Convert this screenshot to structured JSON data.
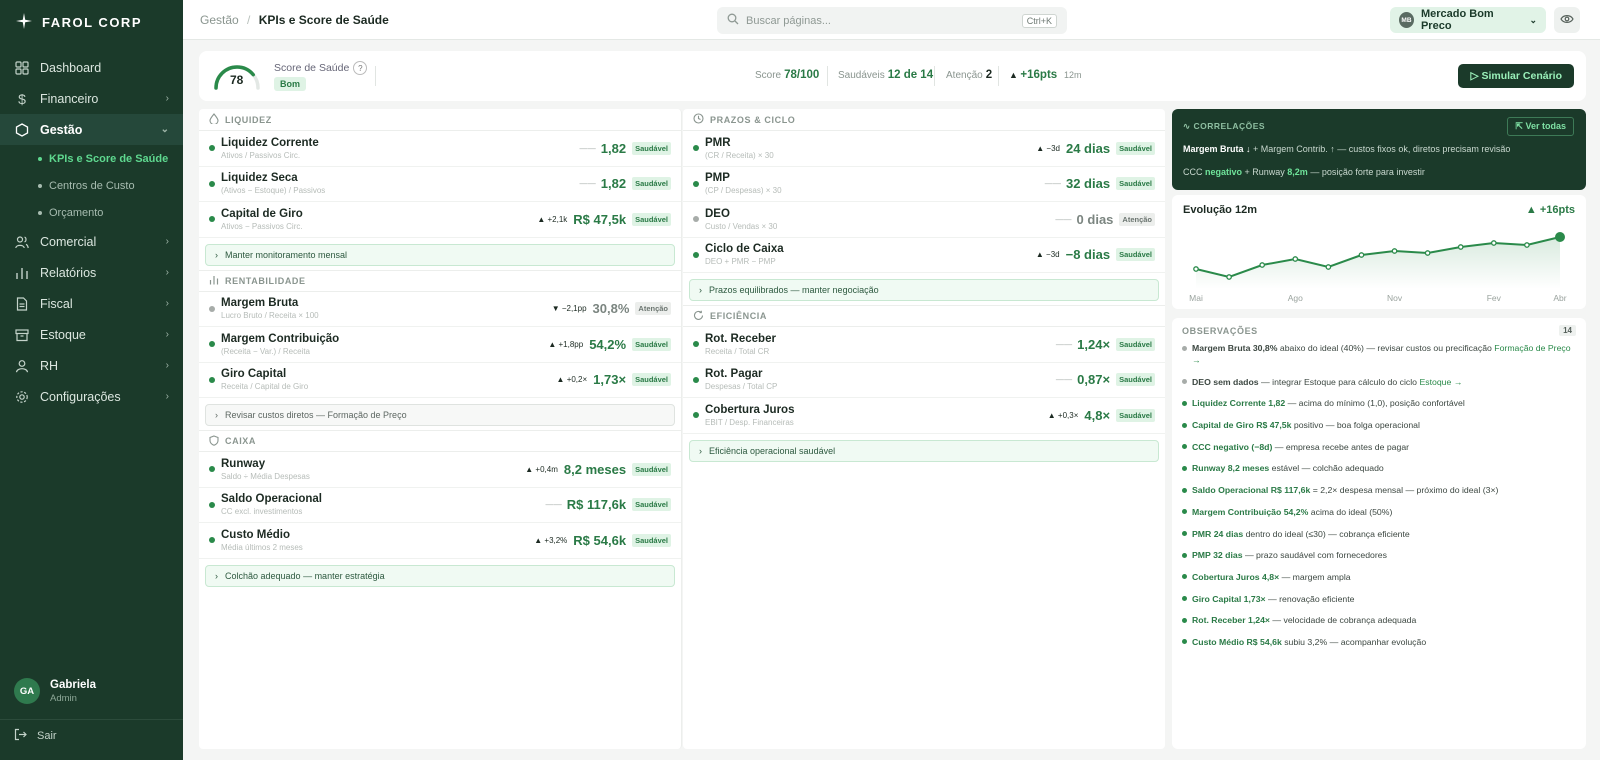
{
  "sidebar": {
    "brand": "FAROL CORP",
    "items": [
      {
        "label": "Dashboard",
        "icon": "grid-icon",
        "chev": false
      },
      {
        "label": "Financeiro",
        "icon": "dollar-icon",
        "chev": true
      },
      {
        "label": "Gestão",
        "icon": "hexagon-icon",
        "chev": true,
        "active": true
      },
      {
        "label": "Comercial",
        "icon": "users-icon",
        "chev": true
      },
      {
        "label": "Relatórios",
        "icon": "bar-chart-icon",
        "chev": true
      },
      {
        "label": "Fiscal",
        "icon": "file-icon",
        "chev": true
      },
      {
        "label": "Estoque",
        "icon": "box-icon",
        "chev": true
      },
      {
        "label": "RH",
        "icon": "user-icon",
        "chev": true
      },
      {
        "label": "Configurações",
        "icon": "gear-icon",
        "chev": true
      }
    ],
    "subitems": [
      "KPIs e Score de Saúde",
      "Centros de Custo",
      "Orçamento"
    ],
    "user": {
      "initials": "GA",
      "name": "Gabriela",
      "role": "Admin"
    },
    "logout": "Sair"
  },
  "topbar": {
    "crumb_parent": "Gestão",
    "crumb_sep": "/",
    "crumb_current": "KPIs e Score de Saúde",
    "search_placeholder": "Buscar páginas...",
    "search_kbd": "Ctrl+K",
    "company_initials": "MB",
    "company": "Mercado Bom Preco"
  },
  "score": {
    "value": "78",
    "label": "Score de Saúde",
    "help": "?",
    "status": "Bom",
    "score_label": "Score",
    "score_value": "78/100",
    "healthy_label": "Saudáveis",
    "healthy_value": "12 de 14",
    "attention_label": "Atenção",
    "attention_value": "2",
    "delta": "+16pts",
    "delta_period": "12m",
    "simulate": "Simular Cenário",
    "gauge_fraction": 0.78
  },
  "col1": {
    "s1": {
      "title": "LIQUIDEZ",
      "rows": [
        {
          "name": "Liquidez Corrente",
          "sub": "Ativos / Passivos Circ.",
          "delta": "— —",
          "value": "1,82",
          "status": "Saudável"
        },
        {
          "name": "Liquidez Seca",
          "sub": "(Ativos − Estoque) / Passivos",
          "delta": "— —",
          "value": "1,82",
          "status": "Saudável"
        },
        {
          "name": "Capital de Giro",
          "sub": "Ativos − Passivos Circ.",
          "delta": "▲ +2,1k",
          "value": "R$ 47,5k",
          "status": "Saudável"
        }
      ],
      "note": "Manter monitoramento mensal"
    },
    "s2": {
      "title": "RENTABILIDADE",
      "rows": [
        {
          "name": "Margem Bruta",
          "sub": "Lucro Bruto / Receita × 100",
          "delta": "▼ −2,1pp",
          "value": "30,8%",
          "status": "Atenção"
        },
        {
          "name": "Margem Contribuição",
          "sub": "(Receita − Var.) / Receita",
          "delta": "▲ +1,8pp",
          "value": "54,2%",
          "status": "Saudável"
        },
        {
          "name": "Giro Capital",
          "sub": "Receita / Capital de Giro",
          "delta": "▲ +0,2×",
          "value": "1,73×",
          "status": "Saudável"
        }
      ],
      "note": "Revisar custos diretos — Formação de Preço"
    },
    "s3": {
      "title": "CAIXA",
      "rows": [
        {
          "name": "Runway",
          "sub": "Saldo ÷ Média Despesas",
          "delta": "▲ +0,4m",
          "value": "8,2 meses",
          "status": "Saudável"
        },
        {
          "name": "Saldo Operacional",
          "sub": "CC excl. investimentos",
          "delta": "— —",
          "value": "R$ 117,6k",
          "status": "Saudável"
        },
        {
          "name": "Custo Médio",
          "sub": "Média últimos 2 meses",
          "delta": "▲ +3,2%",
          "value": "R$ 54,6k",
          "status": "Saudável"
        }
      ],
      "note": "Colchão adequado — manter estratégia"
    }
  },
  "col2": {
    "s1": {
      "title": "PRAZOS & CICLO",
      "rows": [
        {
          "name": "PMR",
          "sub": "(CR / Receita) × 30",
          "delta": "▲ −3d",
          "value": "24 dias",
          "status": "Saudável"
        },
        {
          "name": "PMP",
          "sub": "(CP / Despesas) × 30",
          "delta": "— —",
          "value": "32 dias",
          "status": "Saudável"
        },
        {
          "name": "DEO",
          "sub": "Custo / Vendas × 30",
          "delta": "— —",
          "value": "0 dias",
          "status": "Atenção"
        },
        {
          "name": "Ciclo de Caixa",
          "sub": "DEO + PMR − PMP",
          "delta": "▲ −3d",
          "value": "−8 dias",
          "status": "Saudável"
        }
      ],
      "note": "Prazos equilibrados — manter negociação"
    },
    "s2": {
      "title": "EFICIÊNCIA",
      "rows": [
        {
          "name": "Rot. Receber",
          "sub": "Receita / Total CR",
          "delta": "— —",
          "value": "1,24×",
          "status": "Saudável"
        },
        {
          "name": "Rot. Pagar",
          "sub": "Despesas / Total CP",
          "delta": "— —",
          "value": "0,87×",
          "status": "Saudável"
        },
        {
          "name": "Cobertura Juros",
          "sub": "EBIT / Desp. Financeiras",
          "delta": "▲ +0,3×",
          "value": "4,8×",
          "status": "Saudável"
        }
      ],
      "note": "Eficiência operacional saudável"
    }
  },
  "correlations": {
    "title": "CORRELAÇÕES",
    "button": "Ver todas",
    "l1a": "Margem Bruta ↓",
    "l1b": " + Margem Contrib. ↑ — custos fixos ok, diretos precisam revisão",
    "l2a": "CCC ",
    "l2b": "negativo",
    "l2c": " + Runway ",
    "l2d": "8,2m",
    "l2e": " — posição forte para investir"
  },
  "evolution": {
    "title": "Evolução 12m",
    "delta": "▲ +16pts"
  },
  "chart_data": {
    "type": "area",
    "title": "Evolução 12m",
    "x": [
      "Mai",
      "Jun",
      "Jul",
      "Ago",
      "Set",
      "Out",
      "Nov",
      "Dez",
      "Jan",
      "Fev",
      "Mar",
      "Abr"
    ],
    "x_tick_labels": [
      "Mai",
      "Ago",
      "Nov",
      "Fev",
      "Abr"
    ],
    "values": [
      62,
      58,
      64,
      67,
      63,
      69,
      71,
      70,
      73,
      75,
      74,
      78
    ],
    "ylim": [
      55,
      80
    ],
    "grid": false,
    "color": "#2a8a4a"
  },
  "observations": {
    "title": "OBSERVAÇÕES",
    "count": "14",
    "items": [
      {
        "dot": "grey",
        "bold": "Margem Bruta 30,8%",
        "text": " abaixo do ideal (40%) — revisar custos ou precificação ",
        "link": "Formação de Preço →"
      },
      {
        "dot": "grey",
        "bold": "DEO sem dados",
        "text": " — integrar Estoque para cálculo do ciclo ",
        "link": "Estoque →"
      },
      {
        "dot": "green",
        "bold": "Liquidez Corrente 1,82",
        "text": " — acima do mínimo (1,0), posição confortável",
        "link": ""
      },
      {
        "dot": "green",
        "bold": "Capital de Giro R$ 47,5k",
        "text": " positivo — boa folga operacional",
        "link": ""
      },
      {
        "dot": "green",
        "bold": "CCC negativo (−8d)",
        "text": " — empresa recebe antes de pagar",
        "link": ""
      },
      {
        "dot": "green",
        "bold": "Runway 8,2 meses",
        "text": " estável — colchão adequado",
        "link": ""
      },
      {
        "dot": "green",
        "bold": "Saldo Operacional R$ 117,6k",
        "text": " = 2,2× despesa mensal — próximo do ideal (3×)",
        "link": ""
      },
      {
        "dot": "green",
        "bold": "Margem Contribuição 54,2%",
        "text": " acima do ideal (50%)",
        "link": ""
      },
      {
        "dot": "green",
        "bold": "PMR 24 dias",
        "text": " dentro do ideal (≤30) — cobrança eficiente",
        "link": ""
      },
      {
        "dot": "green",
        "bold": "PMP 32 dias",
        "text": " — prazo saudável com fornecedores",
        "link": ""
      },
      {
        "dot": "green",
        "bold": "Cobertura Juros 4,8×",
        "text": " — margem ampla",
        "link": ""
      },
      {
        "dot": "green",
        "bold": "Giro Capital 1,73×",
        "text": " — renovação eficiente",
        "link": ""
      },
      {
        "dot": "green",
        "bold": "Rot. Receber 1,24×",
        "text": " — velocidade de cobrança adequada",
        "link": ""
      },
      {
        "dot": "green",
        "bold": "Custo Médio R$ 54,6k",
        "text": " subiu 3,2% — acompanhar evolução",
        "link": ""
      }
    ]
  }
}
